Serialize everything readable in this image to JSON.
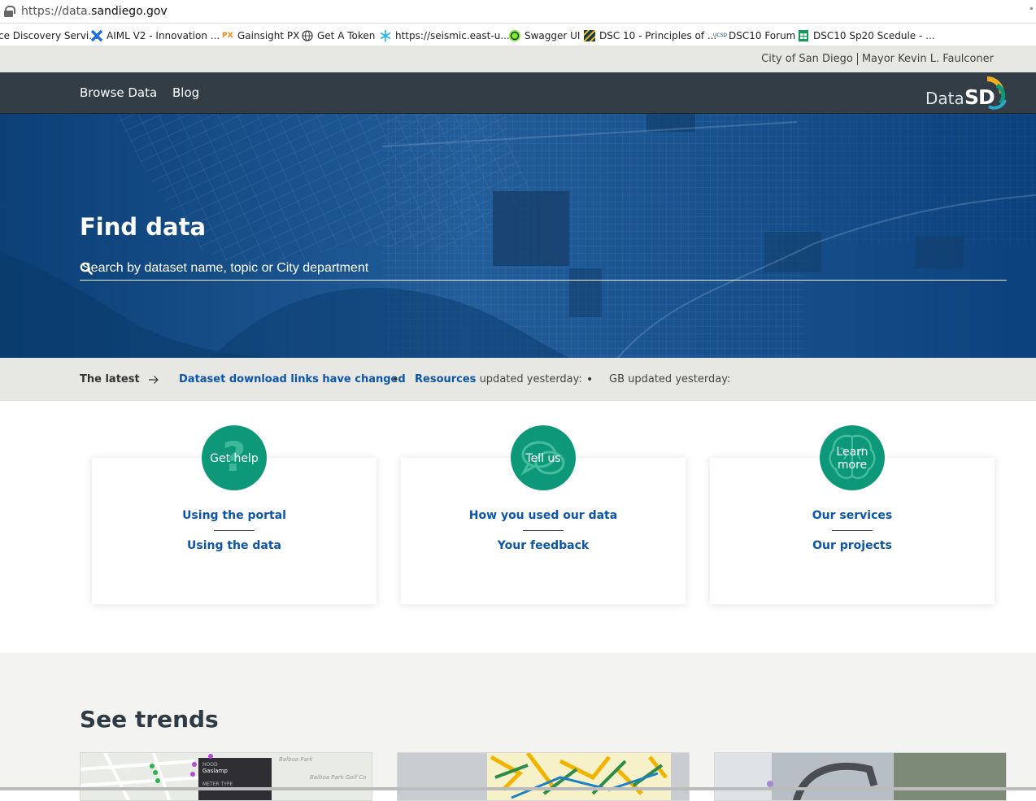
{
  "browser": {
    "url_scheme": "https://data.",
    "url_domain": "sandiego.gov"
  },
  "bookmarks": [
    {
      "label": "ce Discovery Servi...",
      "icon": "blank"
    },
    {
      "label": "AIML V2 - Innovation ...",
      "icon": "x-logo-icon"
    },
    {
      "label": "Gainsight PX",
      "icon": "px-icon"
    },
    {
      "label": "Get A Token",
      "icon": "globe-icon"
    },
    {
      "label": "https://seismic.east-u...",
      "icon": "snowflake-icon"
    },
    {
      "label": "Swagger UI",
      "icon": "swagger-icon"
    },
    {
      "label": "DSC 10 - Principles of ...",
      "icon": "stripes-icon"
    },
    {
      "label": "DSC10 Forum",
      "icon": "ucsd-icon"
    },
    {
      "label": "DSC10 Sp20 Scedule - ...",
      "icon": "sheets-icon"
    }
  ],
  "citybar": {
    "city": "City of San Diego",
    "mayor": "Mayor Kevin L. Faulconer"
  },
  "nav": {
    "items": [
      "Browse Data",
      "Blog"
    ],
    "logo_data": "Data",
    "logo_sd": "SD"
  },
  "hero": {
    "title": "Find data",
    "search_placeholder": "Search by dataset name, topic or City department"
  },
  "latest": {
    "label": "The latest",
    "item1": "Dataset download links have changed",
    "item2_link": "Resources",
    "item2_text": " updated yesterday:",
    "item3_text": "GB updated yesterday:"
  },
  "cards": [
    {
      "circle": "Get help",
      "link1": "Using the portal",
      "link2": "Using the data",
      "icon": "question-icon"
    },
    {
      "circle": "Tell us",
      "link1": "How you used our data",
      "link2": "Your feedback",
      "icon": "chat-bubbles-icon"
    },
    {
      "circle_line1": "Learn",
      "circle_line2": "more",
      "link1": "Our services",
      "link2": "Our projects",
      "icon": "brain-icon"
    }
  ],
  "trends": {
    "title": "See trends",
    "thumb1_labels": [
      "Balboa Park",
      "Balboa Park Golf Co",
      "HOOD",
      "Gaslamp",
      "METER TYPE"
    ]
  },
  "colors": {
    "nav_bg": "#333d46",
    "hero_blue": "#0e4a86",
    "accent_green": "#0d9979",
    "link_blue": "#0c55a8",
    "strip_gray": "#e7e7e4"
  }
}
